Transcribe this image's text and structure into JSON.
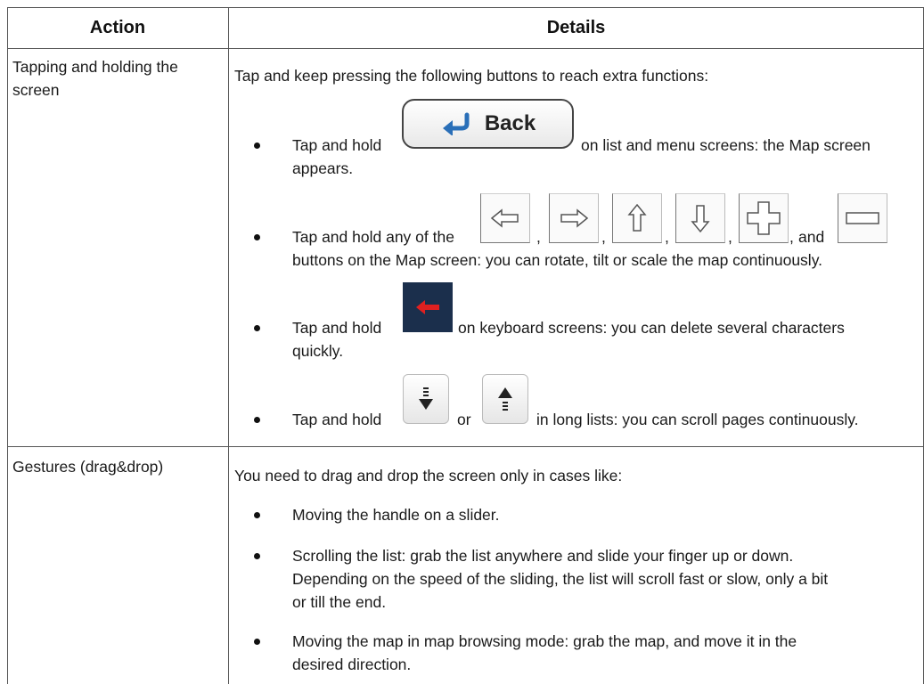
{
  "table": {
    "header": {
      "action": "Action",
      "details": "Details"
    },
    "rows": [
      {
        "action": "Tapping and holding the screen",
        "intro": "Tap and keep pressing the following buttons to reach extra functions:",
        "items": [
          {
            "before": "Tap and hold",
            "after": "on list and menu screens: the Map screen",
            "line2": "appears."
          },
          {
            "before": "Tap and hold any of the",
            "sep1": ",",
            "sep2": ",",
            "sep3": ",",
            "sep4": ",",
            "sep5": ",",
            "and": "and",
            "line2": "buttons on the Map screen: you can rotate, tilt or scale the map continuously."
          },
          {
            "before": "Tap and hold",
            "after": "on keyboard screens: you can delete several characters",
            "line2": "quickly."
          },
          {
            "before": "Tap and hold",
            "or": "or",
            "after": "in long lists: you can scroll pages continuously."
          }
        ]
      },
      {
        "action": "Gestures (drag&drop)",
        "intro": "You need to drag and drop the screen only in cases like:",
        "items": [
          {
            "line1": "Moving the handle on a slider."
          },
          {
            "line1": "Scrolling the list: grab the list anywhere and slide your finger up or down.",
            "line2": "Depending on the speed of the sliding, the list will scroll fast or slow, only a bit",
            "line3": "or till the end."
          },
          {
            "line1": "Moving the map in map browsing mode: grab the map, and move it in the",
            "line2": "desired direction."
          }
        ]
      }
    ]
  },
  "buttons": {
    "back_label": "Back",
    "back_icon": "back-arrow-icon",
    "map_icons": [
      "arrow-left-icon",
      "arrow-right-icon",
      "arrow-up-icon",
      "arrow-down-icon",
      "zoom-in-plus-icon",
      "zoom-out-minus-icon"
    ],
    "delete_icon": "backspace-red-arrow-icon",
    "scroll_icons": [
      "page-down-icon",
      "page-up-icon"
    ],
    "accent_blue": "#2a6fb8",
    "delete_bg": "#1b2f4c",
    "delete_arrow": "#e02020"
  }
}
